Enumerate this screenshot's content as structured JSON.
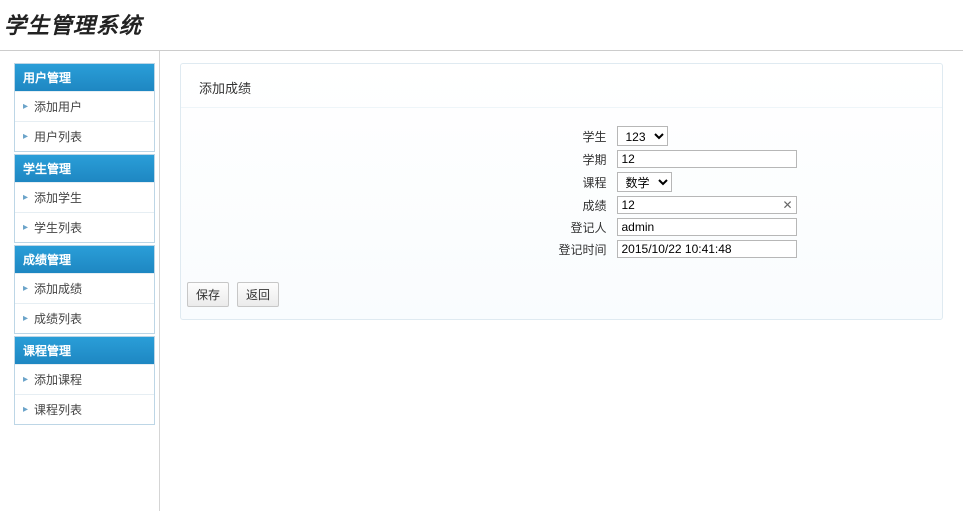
{
  "header": {
    "title": "学生管理系统"
  },
  "sidebar": {
    "groups": [
      {
        "header": "用户管理",
        "items": [
          "添加用户",
          "用户列表"
        ]
      },
      {
        "header": "学生管理",
        "items": [
          "添加学生",
          "学生列表"
        ]
      },
      {
        "header": "成绩管理",
        "items": [
          "添加成绩",
          "成绩列表"
        ]
      },
      {
        "header": "课程管理",
        "items": [
          "添加课程",
          "课程列表"
        ]
      }
    ]
  },
  "panel": {
    "title": "添加成绩",
    "form": {
      "student_label": "学生",
      "student_value": "123",
      "term_label": "学期",
      "term_value": "12",
      "course_label": "课程",
      "course_value": "数学",
      "score_label": "成绩",
      "score_value": "12",
      "registrant_label": "登记人",
      "registrant_value": "admin",
      "regtime_label": "登记时间",
      "regtime_value": "2015/10/22 10:41:48"
    },
    "buttons": {
      "save": "保存",
      "back": "返回"
    }
  }
}
